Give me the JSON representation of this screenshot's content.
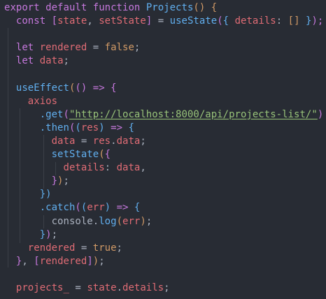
{
  "editor": {
    "language": "javascript",
    "theme": {
      "background": "#282c34",
      "keyword": "#c678dd",
      "function": "#61afef",
      "variable": "#e06c75",
      "string": "#98c379",
      "bracket_gold": "#d19a66",
      "plain": "#abb2bf"
    },
    "lines": [
      {
        "tokens": [
          "export",
          " ",
          "default",
          " ",
          "function",
          " ",
          "Projects",
          "()",
          " ",
          "{"
        ]
      },
      {
        "tokens": [
          "  ",
          "const",
          " ",
          "[",
          "state",
          ", ",
          "setState",
          "]",
          " = ",
          "useState",
          "(",
          "{",
          " ",
          "details",
          ": ",
          "[]",
          " ",
          "}",
          ");"
        ]
      },
      {
        "tokens": []
      },
      {
        "tokens": [
          "  ",
          "let",
          " ",
          "rendered",
          " = ",
          "false",
          ";"
        ]
      },
      {
        "tokens": [
          "  ",
          "let",
          " ",
          "data",
          ";"
        ]
      },
      {
        "tokens": []
      },
      {
        "tokens": [
          "  ",
          "useEffect",
          "(",
          "()",
          " => ",
          "{"
        ]
      },
      {
        "tokens": [
          "    ",
          "axios"
        ]
      },
      {
        "tokens": [
          "      ",
          ".get",
          "(",
          "\"http://localhost:8000/api/projects-list/\"",
          ")"
        ]
      },
      {
        "tokens": [
          "      ",
          ".then",
          "(",
          "(",
          "res",
          ")",
          " => ",
          "{"
        ]
      },
      {
        "tokens": [
          "        ",
          "data",
          " = ",
          "res",
          ".",
          "data",
          ";"
        ]
      },
      {
        "tokens": [
          "        ",
          "setState",
          "(",
          "{"
        ]
      },
      {
        "tokens": [
          "          ",
          "details",
          ": ",
          "data",
          ","
        ]
      },
      {
        "tokens": [
          "        ",
          "}",
          ")",
          ";"
        ]
      },
      {
        "tokens": [
          "      ",
          "})"
        ]
      },
      {
        "tokens": [
          "      ",
          ".catch",
          "(",
          "(",
          "err",
          ")",
          " => ",
          "{"
        ]
      },
      {
        "tokens": [
          "        ",
          "console",
          ".",
          "log",
          "(",
          "err",
          ")",
          ";"
        ]
      },
      {
        "tokens": [
          "      ",
          "}",
          ")",
          ";"
        ]
      },
      {
        "tokens": [
          "    ",
          "rendered",
          " = ",
          "true",
          ";"
        ]
      },
      {
        "tokens": [
          "  ",
          "}",
          ", ",
          "[",
          "rendered",
          "]",
          ")",
          ";"
        ]
      },
      {
        "tokens": []
      },
      {
        "tokens": [
          "  ",
          "projects_",
          " = ",
          "state",
          ".",
          "details",
          ";"
        ]
      }
    ]
  }
}
